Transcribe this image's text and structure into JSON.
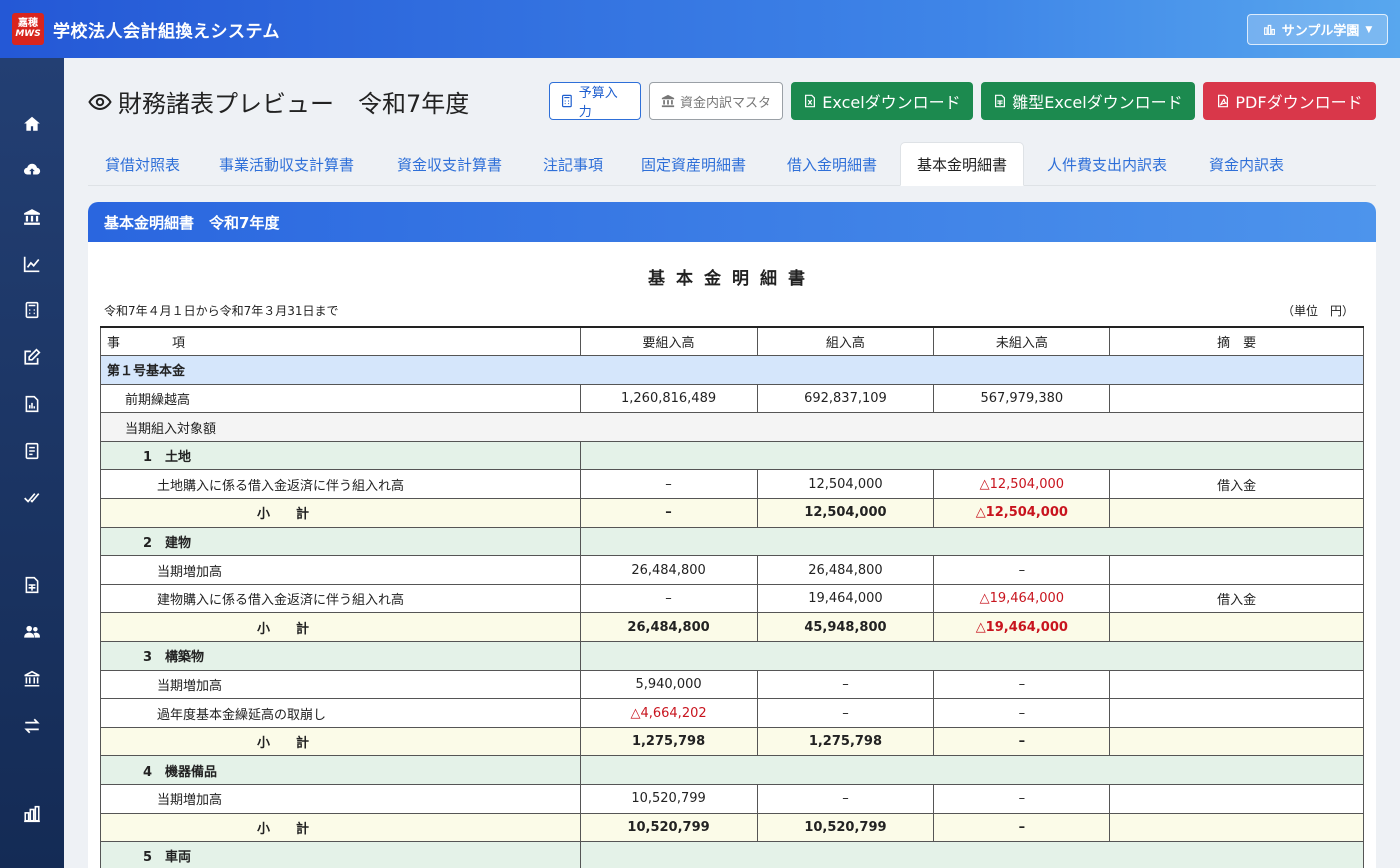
{
  "header": {
    "logo_top": "嘉穂",
    "logo_bottom": "MWS",
    "title": "学校法人会計組換えシステム",
    "school_selector": "サンプル学園"
  },
  "sidebar": {
    "icons": [
      "home-icon",
      "cloud-upload-icon",
      "bank-icon",
      "chart-line-icon",
      "calculator-icon",
      "edit-icon",
      "file-chart-icon",
      "journal-icon",
      "check-double-icon",
      "file-spreadsheet-icon",
      "users-icon",
      "institution-icon",
      "exchange-icon",
      "building-chart-icon"
    ]
  },
  "page": {
    "title": "財務諸表プレビュー　令和7年度"
  },
  "buttons": {
    "budget": "予算入力",
    "fund_master": "資金内訳マスタ",
    "excel": "Excelダウンロード",
    "template_excel": "雛型Excelダウンロード",
    "pdf": "PDFダウンロード"
  },
  "tabs": [
    "貸借対照表",
    "事業活動収支計算書",
    "資金収支計算書",
    "注記事項",
    "固定資産明細書",
    "借入金明細書",
    "基本金明細書",
    "人件費支出内訳表",
    "資金内訳表"
  ],
  "card": {
    "header": "基本金明細書　令和7年度",
    "doc_title": "基本金明細書",
    "period": "令和7年４月１日から令和7年３月31日まで",
    "unit": "（単位　円）"
  },
  "table": {
    "columns": [
      "事　　　　項",
      "要組入高",
      "組入高",
      "未組入高",
      "摘　要"
    ],
    "rows": {
      "r0": {
        "item": "第１号基本金"
      },
      "r1": {
        "item": "前期繰越高",
        "req": "1,260,816,489",
        "inc": "692,837,109",
        "un": "567,979,380",
        "note": ""
      },
      "r2": {
        "item": "当期組入対象額"
      },
      "r3": {
        "item": "1　土地"
      },
      "r4": {
        "item": "土地購入に係る借入金返済に伴う組入れ高",
        "req": "–",
        "inc": "12,504,000",
        "un": "△12,504,000",
        "note": "借入金"
      },
      "r5": {
        "item": "小　　計",
        "req": "–",
        "inc": "12,504,000",
        "un": "△12,504,000",
        "note": ""
      },
      "r6": {
        "item": "2　建物"
      },
      "r7": {
        "item": "当期増加高",
        "req": "26,484,800",
        "inc": "26,484,800",
        "un": "–",
        "note": ""
      },
      "r8": {
        "item": "建物購入に係る借入金返済に伴う組入れ高",
        "req": "–",
        "inc": "19,464,000",
        "un": "△19,464,000",
        "note": "借入金"
      },
      "r9": {
        "item": "小　　計",
        "req": "26,484,800",
        "inc": "45,948,800",
        "un": "△19,464,000",
        "note": ""
      },
      "r10": {
        "item": "3　構築物"
      },
      "r11": {
        "item": "当期増加高",
        "req": "5,940,000",
        "inc": "–",
        "un": "–",
        "note": ""
      },
      "r12": {
        "item": "過年度基本金繰延高の取崩し",
        "req": "△4,664,202",
        "inc": "–",
        "un": "–",
        "note": ""
      },
      "r13": {
        "item": "小　　計",
        "req": "1,275,798",
        "inc": "1,275,798",
        "un": "–",
        "note": ""
      },
      "r14": {
        "item": "4　機器備品"
      },
      "r15": {
        "item": "当期増加高",
        "req": "10,520,799",
        "inc": "–",
        "un": "–",
        "note": ""
      },
      "r16": {
        "item": "小　　計",
        "req": "10,520,799",
        "inc": "10,520,799",
        "un": "–",
        "note": ""
      },
      "r17": {
        "item": "5　車両"
      }
    }
  },
  "colors": {
    "header_start": "#2458d6",
    "sidebar": "#1b3463",
    "green": "#1c8a4f",
    "red": "#d9374a",
    "negative": "#c8141e"
  }
}
